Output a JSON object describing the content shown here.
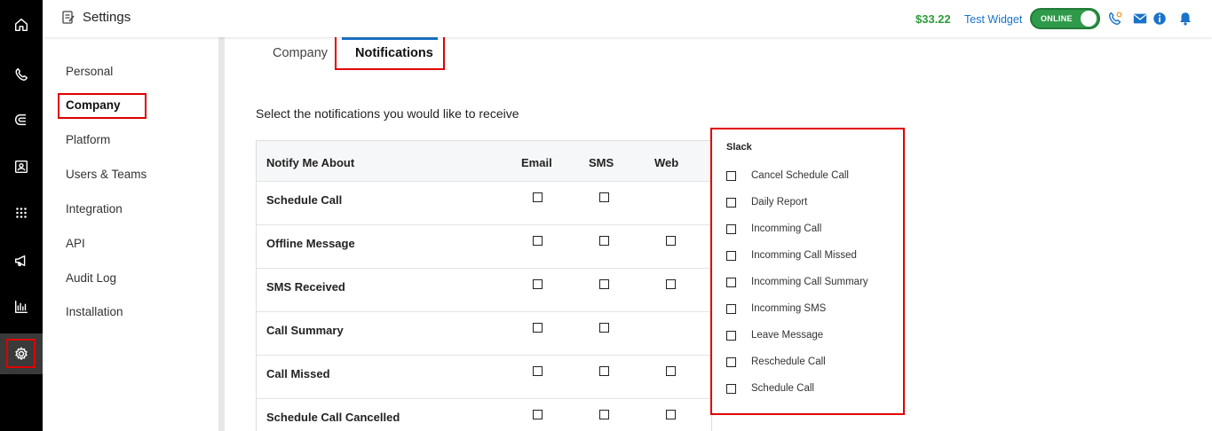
{
  "app": {
    "title": "Settings"
  },
  "header": {
    "balance": "$33.22",
    "widget_name": "Test Widget",
    "status_label": "ONLINE",
    "icons": [
      "phone-settings-icon",
      "mail-icon",
      "info-icon",
      "bell-icon"
    ],
    "accent_color": "#1a73c9",
    "status_color": "#2f9a4a"
  },
  "rail": {
    "icons": [
      "home-icon",
      "phone-icon",
      "magnet-icon",
      "contact-card-icon",
      "dialpad-icon",
      "megaphone-icon",
      "analytics-icon",
      "gear-icon"
    ],
    "active": "gear-icon"
  },
  "sidebar": {
    "items": [
      {
        "label": "Personal"
      },
      {
        "label": "Company"
      },
      {
        "label": "Platform"
      },
      {
        "label": "Users & Teams"
      },
      {
        "label": "Integration"
      },
      {
        "label": "API"
      },
      {
        "label": "Audit Log"
      },
      {
        "label": "Installation"
      }
    ],
    "active": "Company"
  },
  "tabs": [
    {
      "label": "Company"
    },
    {
      "label": "Notifications"
    }
  ],
  "active_tab": "Notifications",
  "main": {
    "intro": "Select the notifications you would like to receive",
    "table": {
      "headers": [
        "Notify Me About",
        "Email",
        "SMS",
        "Web"
      ],
      "rows": [
        {
          "name": "Schedule Call",
          "email": false,
          "sms": false,
          "web": null
        },
        {
          "name": "Offline Message",
          "email": false,
          "sms": false,
          "web": false
        },
        {
          "name": "SMS Received",
          "email": false,
          "sms": false,
          "web": false
        },
        {
          "name": "Call Summary",
          "email": false,
          "sms": false,
          "web": null
        },
        {
          "name": "Call Missed",
          "email": false,
          "sms": false,
          "web": false
        },
        {
          "name": "Schedule Call Cancelled",
          "email": false,
          "sms": false,
          "web": false
        }
      ]
    },
    "slack": {
      "title": "Slack",
      "items": [
        "Cancel Schedule Call",
        "Daily Report",
        "Incomming Call",
        "Incomming Call Missed",
        "Incomming Call Summary",
        "Incomming SMS",
        "Leave Message",
        "Reschedule Call",
        "Schedule Call"
      ]
    }
  }
}
